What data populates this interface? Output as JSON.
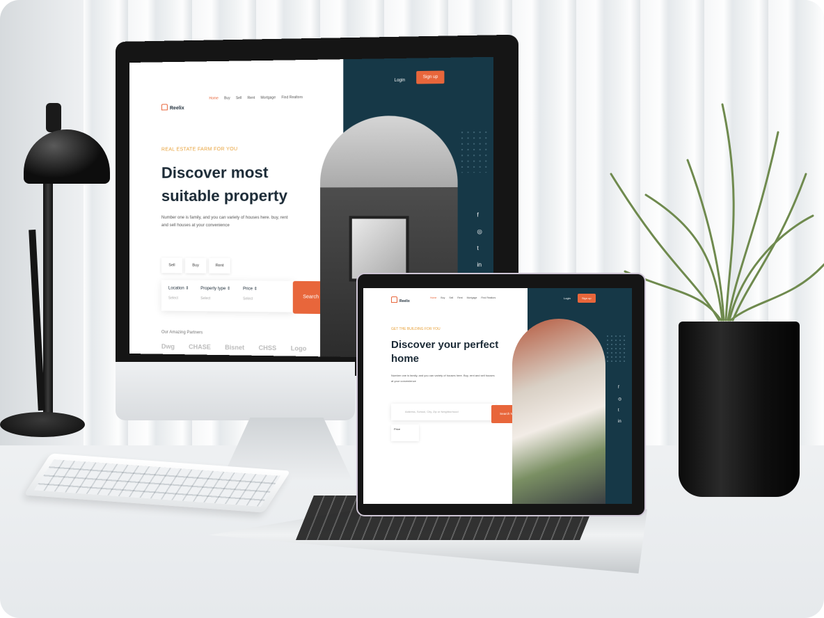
{
  "imac_site": {
    "logo": "Reelix",
    "nav": [
      "Home",
      "Buy",
      "Sell",
      "Rent",
      "Mortgage",
      "Find Realtors"
    ],
    "login": "Login",
    "signup": "Sign up",
    "eyebrow": "REAL ESTATE FARM FOR YOU",
    "title": "Discover most suitable property",
    "text": "Number one is family, and you can variety of houses here. buy, rent and sell houses at your convenience",
    "tabs": [
      "Sell",
      "Buy",
      "Rent"
    ],
    "filters": [
      {
        "label": "Location",
        "value": "Select"
      },
      {
        "label": "Property type",
        "value": "Select"
      },
      {
        "label": "Price",
        "value": "Select"
      }
    ],
    "search_button": "Search Now!",
    "partners_label": "Our Amazing Partners",
    "partners": [
      "Dwg",
      "CHASE",
      "Bisnet",
      "CHSS",
      "Logo"
    ],
    "social": [
      "f",
      "◎",
      "t",
      "in"
    ]
  },
  "laptop_site": {
    "logo": "Reelix",
    "nav": [
      "Home",
      "Buy",
      "Sell",
      "Rent",
      "Mortgage",
      "Find Realtors"
    ],
    "login": "Login",
    "signup": "Sign up",
    "eyebrow": "GET THE BUILDING FOR YOU",
    "title": "Discover your perfect home",
    "text": "Number one is family, and you can variety of houses here. Buy, rent and sell houses at your convenience",
    "search_placeholder": "Address, School, City, Zip or Neighborhood",
    "search_button": "Search Now!",
    "filter": "Price",
    "social": [
      "f",
      "◎",
      "t",
      "in"
    ]
  }
}
